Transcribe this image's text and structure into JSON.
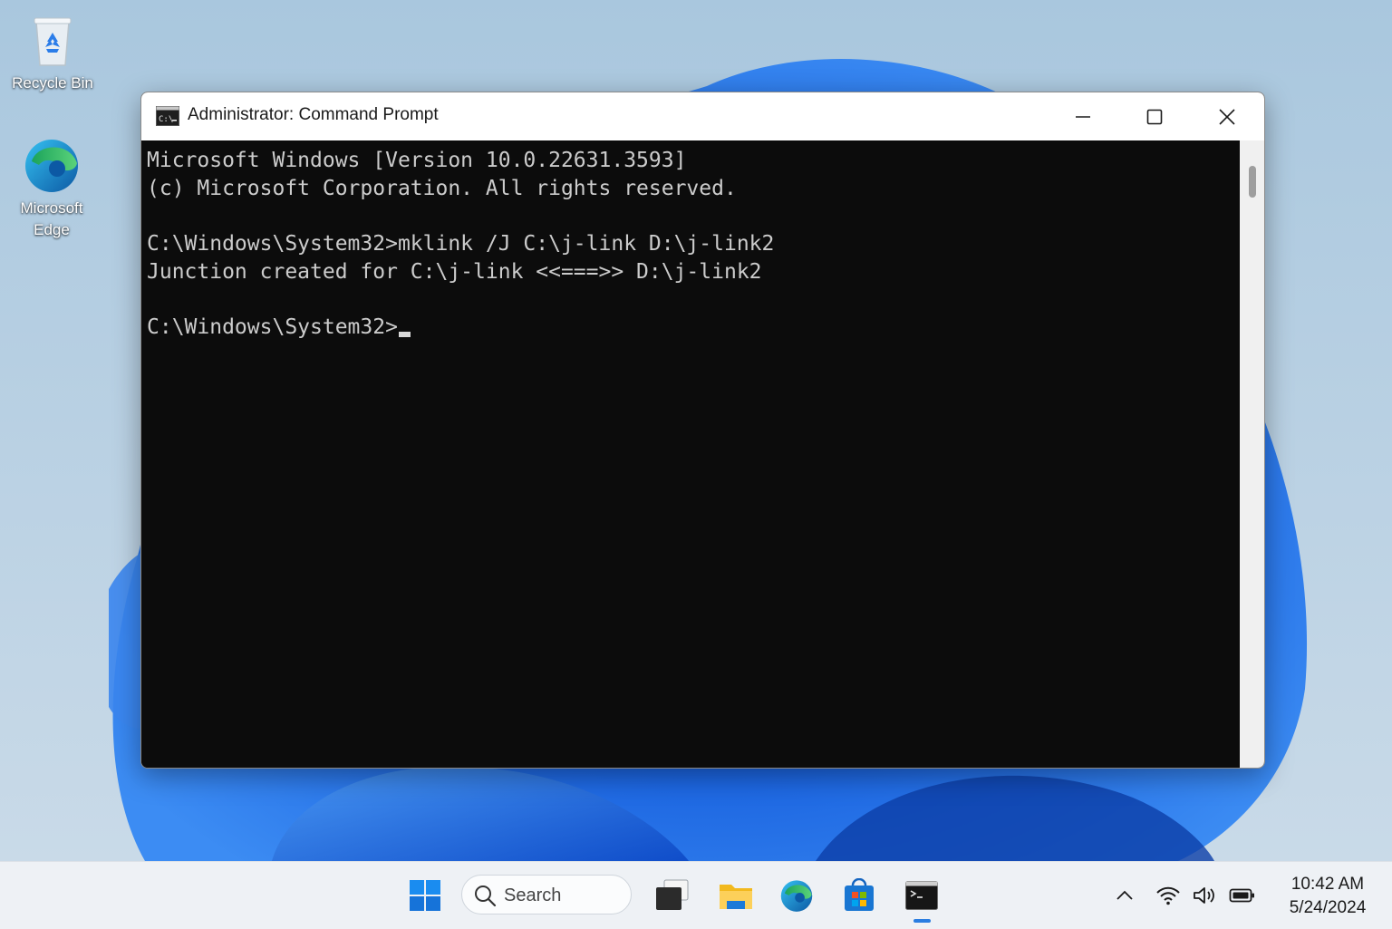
{
  "desktop": {
    "icons": [
      {
        "label": "Recycle Bin",
        "icon": "recycle-bin-icon"
      },
      {
        "label": "Microsoft Edge",
        "icon": "edge-icon"
      }
    ]
  },
  "window": {
    "title": "Administrator: Command Prompt",
    "icon": "cmd-icon",
    "controls": [
      "minimize",
      "maximize",
      "close"
    ]
  },
  "console": {
    "lines": [
      "Microsoft Windows [Version 10.0.22631.3593]",
      "(c) Microsoft Corporation. All rights reserved.",
      "",
      "C:\\Windows\\System32>mklink /J C:\\j-link D:\\j-link2",
      "Junction created for C:\\j-link <<===>> D:\\j-link2",
      "",
      "C:\\Windows\\System32>"
    ]
  },
  "taskbar": {
    "search_label": "Search",
    "apps": [
      "start-icon",
      "task-view-icon",
      "file-explorer-icon",
      "edge-icon",
      "store-icon",
      "terminal-icon"
    ],
    "tray": [
      "chevron-up-icon",
      "wifi-icon",
      "volume-icon",
      "battery-icon"
    ],
    "time": "10:42 AM",
    "date": "5/24/2024"
  },
  "colors": {
    "console_bg": "#0c0c0c",
    "console_text": "#cccccc",
    "accent": "#2a7de1"
  }
}
